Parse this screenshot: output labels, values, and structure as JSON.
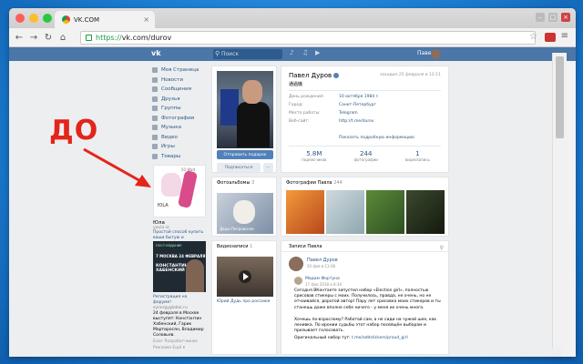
{
  "browser": {
    "tab_title": "VK.COM",
    "url_secure": "https://",
    "url_rest": "vk.com/durov"
  },
  "vk_header": {
    "logo": "vk",
    "search_placeholder": "Поиск",
    "user_name": "Павел"
  },
  "left_menu": [
    {
      "label": "Моя Страница",
      "icon": "home-icon"
    },
    {
      "label": "Новости",
      "icon": "news-icon"
    },
    {
      "label": "Сообщения",
      "icon": "messages-icon"
    },
    {
      "label": "Друзья",
      "icon": "friends-icon"
    },
    {
      "label": "Группы",
      "icon": "groups-icon"
    },
    {
      "label": "Фотографии",
      "icon": "photos-icon"
    },
    {
      "label": "Музыка",
      "icon": "music-icon"
    },
    {
      "label": "Видео",
      "icon": "video-icon"
    },
    {
      "label": "Игры",
      "icon": "games-icon"
    },
    {
      "label": "Товары",
      "icon": "market-icon"
    }
  ],
  "ad1": {
    "badge": "50 Walt",
    "brand": "ЮLA",
    "title": "Юла",
    "source": "youla.io",
    "text": "Простой способ купить ваши бытую и недорого!"
  },
  "ad2": {
    "top_line": "ПОСТ·ИЗДАНИЕ",
    "date_line": "7 МОСКВА 24 ФЕВРАЛЯ",
    "headline": "КОНСТАНТИН ХАБЕНСКИЙ",
    "caption_link": "Регистрация на форуме!",
    "caption_src": "synergyglobal.ru",
    "caption_text": "24 февраля в Москве выступят: Константин Хабенский, Гарик Мартиросян, Владимир Соловьев."
  },
  "footer": {
    "line1": "Блог   Разработчикам",
    "line2": "Реклама   Ещё ▾"
  },
  "profile": {
    "send_message": "Отправить подарок",
    "subscribe": "Подписаться",
    "more": "···",
    "name": "Павел Дуров",
    "status": "通過機",
    "online": "заходил 25 февраля в 12:11",
    "info": [
      {
        "label": "День рождения:",
        "value": "10 октября 1984 г."
      },
      {
        "label": "Город:",
        "value": "Санкт-Петербург"
      },
      {
        "label": "Место работы:",
        "value": "Telegram"
      },
      {
        "label": "Веб-сайт:",
        "value": "http://t.me/durov"
      }
    ],
    "more_info": "Показать подробную информацию",
    "counts": [
      {
        "n": "5.8M",
        "l": "подписчиков"
      },
      {
        "n": "244",
        "l": "фотографии"
      },
      {
        "n": "1",
        "l": "видеозапись"
      }
    ]
  },
  "photo_albums": {
    "title": "Фотоальбомы",
    "count": "3",
    "caption": "Даша Петровская"
  },
  "videos": {
    "title": "Видеозаписи",
    "count": "1",
    "caption": "Юрий Дудь про россиюя"
  },
  "photos": {
    "title": "Фотографии Павла",
    "count": "244"
  },
  "wall": {
    "title": "Записи Павла",
    "author": "Павел Дуров",
    "date": "20 фев в 11:08",
    "repost_author": "Мадам Фортуна",
    "repost_date": "17 фев 2018 в 8:34",
    "p1": "Сегодня ВКонтакте запустил набор «Election girl», полностью срисовав стикеры с моих. Получилось, правда, не очень, но не отчаивайся, дорогой автор! Пару лет срисовка моих стикеров и ты станешь даже вполне себе ничего - у меня их очень много.",
    "p2": "Хочешь по-взрослому? Работай сам, а не сиди на чужой шее, как ленивка. По иронии судьбы этот набор посвящён выборам и призывает голосовать.",
    "p3_label": "Оригинальный набор тут:",
    "p3_link": "t.me/addstickers/proud_girl"
  },
  "annotation": {
    "label": "ДО",
    "color": "#e4241b"
  }
}
